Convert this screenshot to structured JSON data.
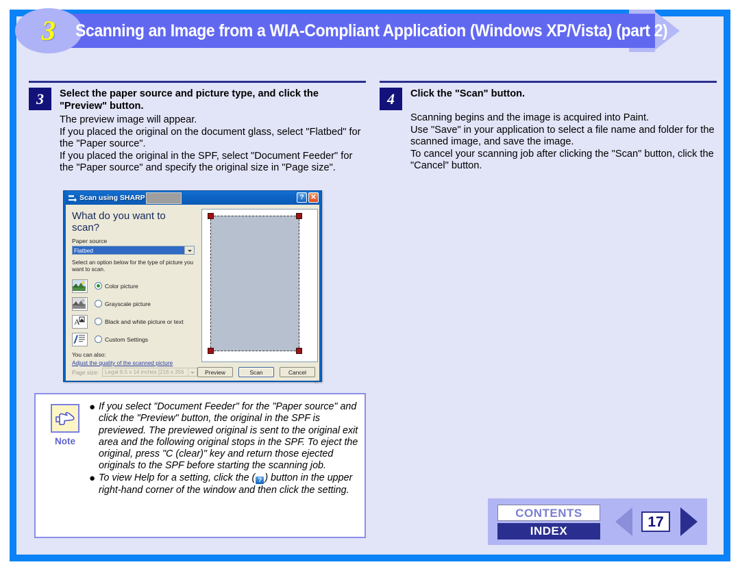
{
  "header": {
    "number": "3",
    "title": "Scanning an Image from a WIA-Compliant Application (Windows XP/Vista) (part 2)"
  },
  "steps": [
    {
      "number": "3",
      "title": "Select the paper source and picture type, and click the \"Preview\" button.",
      "body": "The preview image will appear.\nIf you placed the original on the document glass, select \"Flatbed\" for the \"Paper source\".\nIf you placed the original in the SPF, select \"Document Feeder\" for the \"Paper source\" and specify the original size in \"Page size\"."
    },
    {
      "number": "4",
      "title": "Click the \"Scan\" button.",
      "body": "Scanning begins and the image is acquired into Paint.\nUse \"Save\" in your application to select a file name and folder for the scanned image, and save the image.\nTo cancel your scanning job after clicking the \"Scan\" button, click the \"Cancel\" button."
    }
  ],
  "dialog": {
    "title": "Scan using SHARP",
    "help_button": "?",
    "close_button": "✕",
    "heading": "What do you want to scan?",
    "paper_source_label": "Paper source",
    "paper_source_value": "Flatbed",
    "hint": "Select an option below for the type of picture you want to scan.",
    "options": [
      {
        "label": "Color picture",
        "selected": true
      },
      {
        "label": "Grayscale picture",
        "selected": false
      },
      {
        "label": "Black and white picture or text",
        "selected": false
      },
      {
        "label": "Custom Settings",
        "selected": false
      }
    ],
    "also_label": "You can also:",
    "adjust_link": "Adjust the quality of the scanned picture",
    "page_size_label": "Page size:",
    "page_size_value": "Legal 8.5 x 14 inches [216 x 356",
    "buttons": [
      {
        "label": "Preview",
        "focus": false
      },
      {
        "label": "Scan",
        "focus": true
      },
      {
        "label": "Cancel",
        "focus": false
      }
    ]
  },
  "note": {
    "label": "Note",
    "items": [
      "If you select \"Document Feeder\" for the \"Paper source\" and click the \"Preview\" button, the original in the SPF is previewed. The previewed original is sent to the original exit area and the following original stops in the SPF. To eject the original, press \"C (clear)\" key and return those ejected originals to the SPF before starting the scanning job.",
      "To view Help for a setting, click the (?) button in the upper right-hand corner of the window and then click the setting."
    ],
    "item2_part1": "To view Help for a setting, click the (",
    "item2_icon": "?",
    "item2_part2": ") button in the upper right-hand corner of the window and then click the setting."
  },
  "footer": {
    "contents_label": "CONTENTS",
    "index_label": "INDEX",
    "page_number": "17"
  },
  "colors": {
    "frame_blue": "#0b82f5",
    "page_bg": "#e2e4f7",
    "banner": "#6168f0",
    "banner_accent": "#b4b8f7",
    "banner_number": "#ffff00",
    "navy": "#12127a",
    "rule": "#2a2f8f",
    "note_border": "#8b8ee8",
    "note_icon_bg": "#fdf6c4",
    "dialog_titlebar": "#0d63c3",
    "dialog_face": "#ece9d8",
    "selection_blue": "#316ac5",
    "preview_fill": "#b6c0cf",
    "handle_red": "#9e1111"
  }
}
